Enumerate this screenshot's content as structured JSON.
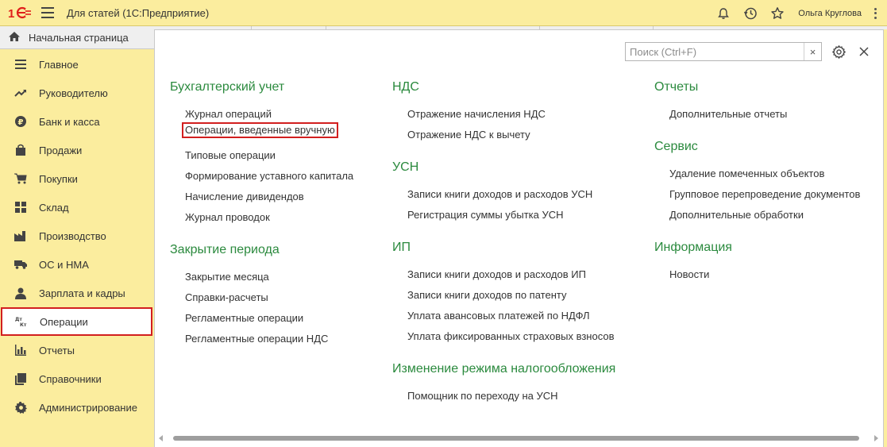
{
  "app": {
    "title": "Для статей  (1С:Предприятие)",
    "user": "Ольга Круглова"
  },
  "home": {
    "label": "Начальная страница"
  },
  "sidebar": {
    "items": [
      {
        "label": "Главное",
        "icon": "menu-lines-icon"
      },
      {
        "label": "Руководителю",
        "icon": "trend-icon"
      },
      {
        "label": "Банк и касса",
        "icon": "ruble-coin-icon"
      },
      {
        "label": "Продажи",
        "icon": "shopping-bag-icon"
      },
      {
        "label": "Покупки",
        "icon": "cart-icon"
      },
      {
        "label": "Склад",
        "icon": "warehouse-grid-icon"
      },
      {
        "label": "Производство",
        "icon": "factory-icon"
      },
      {
        "label": "ОС и НМА",
        "icon": "truck-icon"
      },
      {
        "label": "Зарплата и кадры",
        "icon": "person-icon"
      },
      {
        "label": "Операции",
        "icon": "dt-kt-icon",
        "selected": true
      },
      {
        "label": "Отчеты",
        "icon": "bar-chart-icon"
      },
      {
        "label": "Справочники",
        "icon": "books-icon"
      },
      {
        "label": "Администрирование",
        "icon": "gear-icon"
      }
    ]
  },
  "search": {
    "placeholder": "Поиск (Ctrl+F)",
    "value": "",
    "clear": "×"
  },
  "columns": [
    {
      "sections": [
        {
          "title": "Бухгалтерский учет",
          "links": [
            "Журнал операций",
            "Операции, введенные вручную",
            "Типовые операции",
            "Формирование уставного капитала",
            "Начисление дивидендов",
            "Журнал проводок"
          ]
        },
        {
          "title": "Закрытие периода",
          "links": [
            "Закрытие месяца",
            "Справки-расчеты",
            "Регламентные операции",
            "Регламентные операции НДС"
          ]
        }
      ]
    },
    {
      "sections": [
        {
          "title": "НДС",
          "links": [
            "Отражение начисления НДС",
            "Отражение НДС к вычету"
          ]
        },
        {
          "title": "УСН",
          "links": [
            "Записи книги доходов и расходов УСН",
            "Регистрация суммы убытка УСН"
          ]
        },
        {
          "title": "ИП",
          "links": [
            "Записи книги доходов и расходов ИП",
            "Записи книги доходов по патенту",
            "Уплата авансовых платежей по НДФЛ",
            "Уплата фиксированных страховых взносов"
          ]
        },
        {
          "title": "Изменение режима налогообложения",
          "links": [
            "Помощник по переходу на УСН"
          ]
        }
      ]
    },
    {
      "sections": [
        {
          "title": "Отчеты",
          "links": [
            "Дополнительные отчеты"
          ]
        },
        {
          "title": "Сервис",
          "links": [
            "Удаление помеченных объектов",
            "Групповое перепроведение документов",
            "Дополнительные обработки"
          ]
        },
        {
          "title": "Информация",
          "links": [
            "Новости"
          ]
        }
      ]
    }
  ],
  "highlighted_link": "Операции, введенные вручную",
  "colors": {
    "section_title": "#2b8a3e",
    "highlight": "#d21f1f",
    "sidebar_bg": "#fbed9e"
  }
}
